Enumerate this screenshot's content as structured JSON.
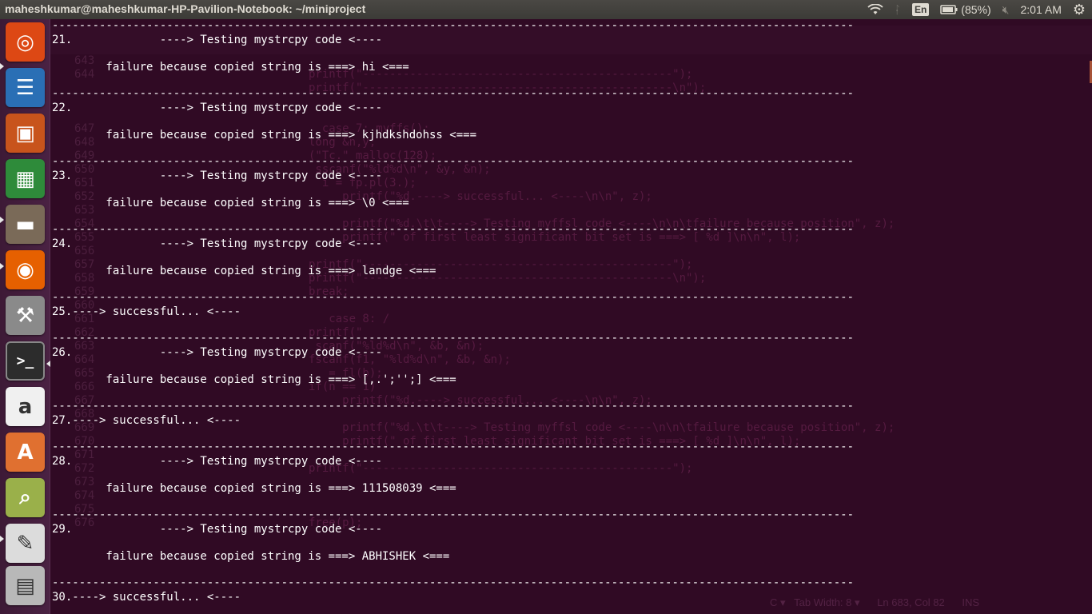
{
  "window": {
    "title": "maheshkumar@maheshkumar-HP-Pavilion-Notebook: ~/miniproject"
  },
  "tray": {
    "keyboard": "En",
    "battery": "(85%)",
    "time": "2:01 AM"
  },
  "launcher": [
    {
      "name": "ubuntu-dash-icon",
      "glyph": "◎",
      "bg": "#dd4814"
    },
    {
      "name": "libreoffice-writer-icon",
      "glyph": "☰",
      "bg": "#2a6fb5"
    },
    {
      "name": "libreoffice-impress-icon",
      "glyph": "▣",
      "bg": "#c8541c"
    },
    {
      "name": "libreoffice-calc-icon",
      "glyph": "▦",
      "bg": "#2e8b3a"
    },
    {
      "name": "files-icon",
      "glyph": "▬",
      "bg": "#7a6a58"
    },
    {
      "name": "firefox-icon",
      "glyph": "◉",
      "bg": "#e66000"
    },
    {
      "name": "system-settings-icon",
      "glyph": "⚒",
      "bg": "#8a8a8a"
    },
    {
      "name": "terminal-icon",
      "glyph": ">_",
      "bg": "#2c2c2c"
    },
    {
      "name": "amazon-icon",
      "glyph": "a",
      "bg": "#f0f0f0"
    },
    {
      "name": "software-center-icon",
      "glyph": "A",
      "bg": "#e07030"
    },
    {
      "name": "system-monitor-icon",
      "glyph": "⌕",
      "bg": "#9ab04a"
    },
    {
      "name": "text-editor-icon",
      "glyph": "✎",
      "bg": "#dcdcdc"
    },
    {
      "name": "workspace-switcher-icon",
      "glyph": "▤",
      "bg": "#b8b8b8"
    }
  ],
  "terminal_lines": [
    "21.             ----> Testing mystrcpy code <----",
    "",
    "        failure because copied string is ===> hi <===",
    "",
    "22.             ----> Testing mystrcpy code <----",
    "",
    "        failure because copied string is ===> kjhdkshdohss <===",
    "",
    "23.             ----> Testing mystrcpy code <----",
    "",
    "        failure because copied string is ===> \\0 <===",
    "",
    "24.             ----> Testing mystrcpy code <----",
    "",
    "        failure because copied string is ===> landge <===",
    "",
    "25.----> successful... <----",
    "",
    "26.             ----> Testing mystrcpy code <----",
    "",
    "        failure because copied string is ===> [,.';'';] <===",
    "",
    "27.----> successful... <----",
    "",
    "28.             ----> Testing mystrcpy code <----",
    "",
    "        failure because copied string is ===> 111508039 <===",
    "",
    "29.             ----> Testing mystrcpy code <----",
    "",
    "        failure because copied string is ===> ABHISHEK <===",
    "",
    "30.----> successful... <----"
  ],
  "separator": "-----------------------------------------------------------------------------------------------------------------------",
  "background_editor": {
    "line_numbers": [
      "643",
      "644",
      "",
      "",
      "",
      "647",
      "648",
      "649",
      "650",
      "651",
      "652",
      "653",
      "654",
      "655",
      "656",
      "657",
      "658",
      "659",
      "660",
      "661",
      "662",
      "663",
      "664",
      "665",
      "666",
      "667",
      "668",
      "669",
      "670",
      "671",
      "672",
      "673",
      "674",
      "675",
      "676"
    ],
    "code": [
      "",
      "printf(\"----------------------------------------------\");",
      "printf(\"----------------------------------------------\\n\");",
      "",
      "",
      "  case 7: myffs();",
      "long &n,y;",
      "(\"Tc.\" malloc(128);",
      " sscanf(\"%ld%d\\n\", &y, &n);",
      "  i = fp.pl(3.);",
      "     printf(\"%d.----> successful... <----\\n\\n\", z);",
      "",
      "     printf(\"%d.\\t\\t----> Testing myffsl code <----\\n\\n\\tfailure because position\", z);",
      "     printf(\" of first least significant bit set is ===> [ %d ]\\n\\n\", l);",
      "",
      "printf(\"----------------------------------------------\");",
      "printf(\"----------------------------------------------\\n\");",
      "break;",
      "",
      "   case 8: /",
      "printf(\"",
      " scanf(\"%ld%d\\n\", &b, &n);",
      "fscanf(f1, \"%ld%d\\n\", &b, &n);",
      "   = fl(b);",
      "if(n == 1)",
      "     printf(\"%d.----> successful... <----\\n\\n\", z);",
      "",
      "     printf(\"%d.\\t\\t----> Testing myffsl code <----\\n\\n\\tfailure because position\", z);",
      "     printf(\" of first least significant bit set is ===> [ %d ]\\n\\n\", l);",
      "",
      "printf(\"----------------------------------------------\");",
      "",
      "",
      "",
      "free(p);"
    ],
    "status": "C ▾   Tab Width: 8 ▾      Ln 683, Col 82      INS"
  }
}
